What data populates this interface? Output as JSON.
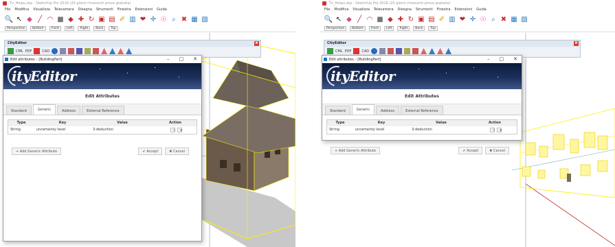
{
  "screens": [
    {
      "su": {
        "title": "Tv_Hoipu.skp - SketchUp Pro 2018 (20 giorni rimanenti prova gratuita)",
        "menu": [
          "File",
          "Modifica",
          "Visualizza",
          "Telecamera",
          "Disegna",
          "Strumenti",
          "Finestra",
          "Estensioni",
          "Guida"
        ],
        "scenes": [
          "Perspective",
          "Bottom",
          "Front",
          "Left",
          "Right",
          "Back",
          "Top"
        ]
      },
      "cityeditor": {
        "title": "CityEditor",
        "labels": [
          "CML",
          "PDF",
          "CAD"
        ]
      },
      "dialog": {
        "title": "Edit attributes – [BuildingPart]",
        "logo": "ityEditor",
        "heading": "Edit Attributes",
        "tabs": [
          "Standard",
          "Generic",
          "Address",
          "External Reference"
        ],
        "active_tab": "Generic",
        "columns": [
          "Type",
          "Key",
          "Value",
          "Action"
        ],
        "rows": [
          {
            "type": "String",
            "key": "uncertainty level",
            "value": "3-deduction"
          }
        ],
        "add_label": "+ Add Generic Attribute",
        "accept_label": "✔ Accept",
        "cancel_label": "✖ Cancel"
      }
    },
    {
      "su": {
        "title": "Tv_Hoipu.skp - SketchUp Pro 2018 (20 giorni rimanenti prova gratuita)",
        "menu": [
          "File",
          "Modifica",
          "Visualizza",
          "Telecamera",
          "Disegna",
          "Strumenti",
          "Finestra",
          "Estensioni",
          "Guida"
        ],
        "scenes": [
          "Perspective",
          "Bottom",
          "Front",
          "Left",
          "Right",
          "Back",
          "Top"
        ]
      },
      "cityeditor": {
        "title": "CityEditor",
        "labels": [
          "CML",
          "PDF",
          "CAD"
        ]
      },
      "dialog": {
        "title": "Edit attributes – [BuildingPart]",
        "logo": "ityEditor",
        "heading": "Edit Attributes",
        "tabs": [
          "Standard",
          "Generic",
          "Address",
          "External Reference"
        ],
        "active_tab": "Generic",
        "columns": [
          "Type",
          "Key",
          "Value",
          "Action"
        ],
        "rows": [
          {
            "type": "String",
            "key": "uncertainty level",
            "value": "3-deduction"
          }
        ],
        "add_label": "+ Add Generic Attribute",
        "accept_label": "✔ Accept",
        "cancel_label": "✖ Cancel"
      }
    }
  ],
  "colors": {
    "selection": "#ffee00",
    "banner": "#1c2f5a",
    "ce_close": "#e03a2a"
  },
  "icons": [
    "search-icon",
    "select-arrow-icon",
    "eraser-icon",
    "pencil-icon",
    "arc-icon",
    "shape-icon",
    "push-pull-icon",
    "move-icon",
    "rotate-icon",
    "scale-icon",
    "offset-icon",
    "tape-measure-icon",
    "paint-bucket-icon",
    "orbit-icon",
    "pan-icon",
    "zoom-icon",
    "zoom-extents-icon"
  ]
}
